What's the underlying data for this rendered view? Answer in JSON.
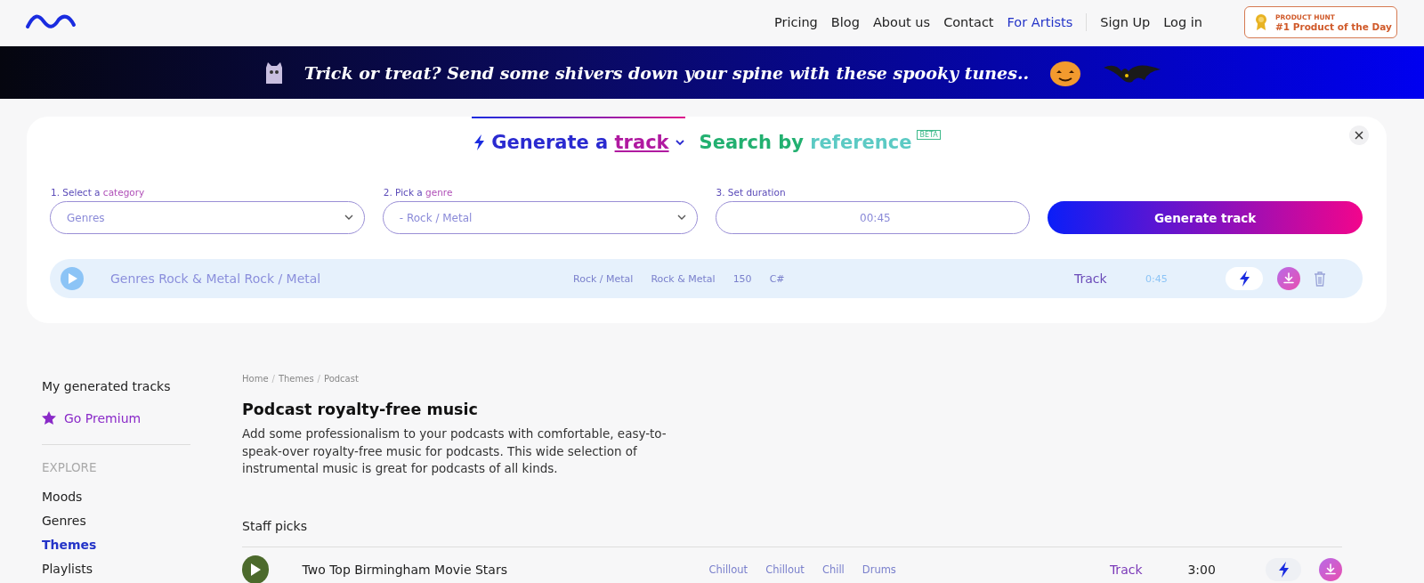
{
  "nav": {
    "links": [
      {
        "label": "Pricing",
        "selected": false
      },
      {
        "label": "Blog",
        "selected": false
      },
      {
        "label": "About us",
        "selected": false
      },
      {
        "label": "Contact",
        "selected": false
      },
      {
        "label": "For Artists",
        "selected": true
      }
    ],
    "auth": [
      "Sign Up",
      "Log in"
    ],
    "badge": {
      "kicker": "PRODUCT HUNT",
      "title": "#1 Product of the Day"
    }
  },
  "banner": {
    "text": "Trick or treat? Send some shivers down your spine with these spooky tunes.."
  },
  "generator": {
    "tabs": [
      {
        "kind": "generate",
        "prefix": "Generate a",
        "word": "track",
        "selected": true
      },
      {
        "kind": "reference",
        "prefix": "Search by",
        "word": "reference",
        "tag": "BETA",
        "selected": false
      }
    ],
    "fields": [
      {
        "kind": "select",
        "label_prefix": "1. Select a",
        "label_word": "category",
        "value": "Genres"
      },
      {
        "kind": "select",
        "label_prefix": "2. Pick a",
        "label_word": "genre",
        "value": "- Rock / Metal"
      },
      {
        "kind": "text",
        "label_prefix": "3. Set duration",
        "value": "00:45"
      }
    ],
    "button": "Generate track",
    "track": {
      "title": "Genres Rock & Metal Rock / Metal",
      "tags": [
        "Rock / Metal",
        "Rock & Metal",
        "150",
        "C#"
      ],
      "type": "Track",
      "duration": "0:45"
    }
  },
  "sidebar": {
    "items": [
      {
        "label": "My generated tracks",
        "kind": "link"
      },
      {
        "label": "Go Premium",
        "kind": "premium"
      }
    ],
    "section": "EXPLORE",
    "explore": [
      {
        "label": "Moods",
        "selected": false
      },
      {
        "label": "Genres",
        "selected": false
      },
      {
        "label": "Themes",
        "selected": true
      },
      {
        "label": "Playlists",
        "selected": false
      }
    ]
  },
  "content": {
    "breadcrumb": [
      {
        "kind": "link",
        "label": "Home"
      },
      {
        "kind": "separator",
        "label": "/"
      },
      {
        "kind": "link",
        "label": "Themes"
      },
      {
        "kind": "separator",
        "label": "/"
      },
      {
        "kind": "link",
        "label": "Podcast"
      }
    ],
    "title": "Podcast royalty-free music",
    "description": "Add some professionalism to your podcasts with comfortable, easy-to-speak-over royalty-free music for podcasts. This wide selection of instrumental music is great for podcasts of all kinds.",
    "section": "Staff picks",
    "tracks": [
      {
        "title": "Two Top Birmingham Movie Stars",
        "tags": [
          "Chillout",
          "Chillout",
          "Chill",
          "Drums"
        ],
        "type": "Track",
        "duration": "3:00"
      }
    ]
  }
}
